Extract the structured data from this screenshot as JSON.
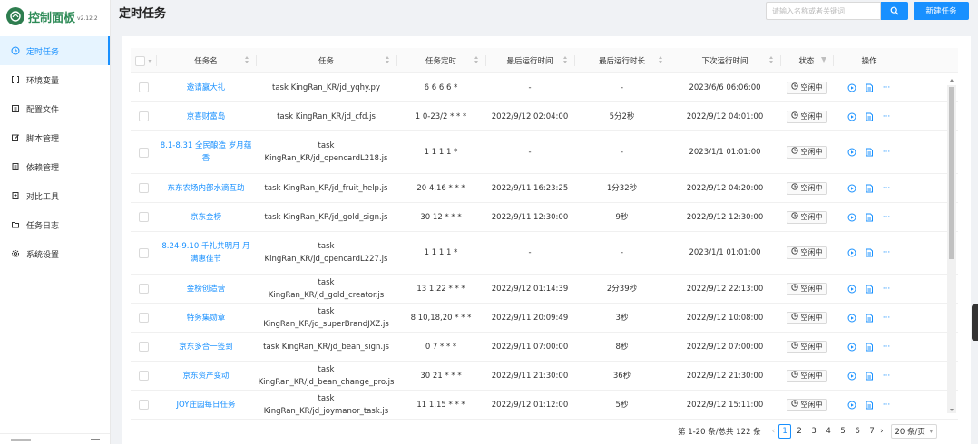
{
  "app": {
    "title": "控制面板",
    "version": "v2.12.2"
  },
  "sidebar": {
    "items": [
      {
        "label": "定时任务",
        "icon": "clock-icon",
        "active": true
      },
      {
        "label": "环境变量",
        "icon": "variable-icon",
        "active": false
      },
      {
        "label": "配置文件",
        "icon": "config-icon",
        "active": false
      },
      {
        "label": "脚本管理",
        "icon": "edit-icon",
        "active": false
      },
      {
        "label": "依赖管理",
        "icon": "dependency-icon",
        "active": false
      },
      {
        "label": "对比工具",
        "icon": "diff-icon",
        "active": false
      },
      {
        "label": "任务日志",
        "icon": "folder-icon",
        "active": false
      },
      {
        "label": "系统设置",
        "icon": "gear-icon",
        "active": false
      }
    ]
  },
  "header": {
    "title": "定时任务",
    "search_placeholder": "请输入名称或者关键词",
    "new_button": "新建任务"
  },
  "table": {
    "columns": [
      "任务名",
      "任务",
      "任务定时",
      "最后运行时间",
      "最后运行时长",
      "下次运行时间",
      "状态",
      "操作"
    ],
    "rows": [
      {
        "name": "邀请赢大礼",
        "task": "task KingRan_KR/jd_yqhy.py",
        "cron": "6 6 6 6 *",
        "last_run": "-",
        "duration": "-",
        "next_run": "2023/6/6 06:06:00",
        "status": "空闲中"
      },
      {
        "name": "京喜财富岛",
        "task": "task KingRan_KR/jd_cfd.js",
        "cron": "1 0-23/2 * * *",
        "last_run": "2022/9/12 02:04:00",
        "duration": "5分2秒",
        "next_run": "2022/9/12 04:01:00",
        "status": "空闲中"
      },
      {
        "name": "8.1-8.31 全民酿造 岁月蕴香",
        "task": "task KingRan_KR/jd_opencardL218.js",
        "cron": "1 1 1 1 *",
        "last_run": "-",
        "duration": "-",
        "next_run": "2023/1/1 01:01:00",
        "status": "空闲中"
      },
      {
        "name": "东东农场内部水滴互助",
        "task": "task KingRan_KR/jd_fruit_help.js",
        "cron": "20 4,16 * * *",
        "last_run": "2022/9/11 16:23:25",
        "duration": "1分32秒",
        "next_run": "2022/9/12 04:20:00",
        "status": "空闲中"
      },
      {
        "name": "京东金榜",
        "task": "task KingRan_KR/jd_gold_sign.js",
        "cron": "30 12 * * *",
        "last_run": "2022/9/11 12:30:00",
        "duration": "9秒",
        "next_run": "2022/9/12 12:30:00",
        "status": "空闲中"
      },
      {
        "name": "8.24-9.10 千礼共明月 月满惠佳节",
        "task": "task KingRan_KR/jd_opencardL227.js",
        "cron": "1 1 1 1 *",
        "last_run": "-",
        "duration": "-",
        "next_run": "2023/1/1 01:01:00",
        "status": "空闲中"
      },
      {
        "name": "金榜创造营",
        "task": "task KingRan_KR/jd_gold_creator.js",
        "cron": "13 1,22 * * *",
        "last_run": "2022/9/12 01:14:39",
        "duration": "2分39秒",
        "next_run": "2022/9/12 22:13:00",
        "status": "空闲中"
      },
      {
        "name": "特务集勋章",
        "task": "task KingRan_KR/jd_superBrandJXZ.js",
        "cron": "8 10,18,20 * * *",
        "last_run": "2022/9/11 20:09:49",
        "duration": "3秒",
        "next_run": "2022/9/12 10:08:00",
        "status": "空闲中"
      },
      {
        "name": "京东多合一签到",
        "task": "task KingRan_KR/jd_bean_sign.js",
        "cron": "0 7 * * *",
        "last_run": "2022/9/11 07:00:00",
        "duration": "8秒",
        "next_run": "2022/9/12 07:00:00",
        "status": "空闲中"
      },
      {
        "name": "京东资产变动",
        "task": "task KingRan_KR/jd_bean_change_pro.js",
        "cron": "30 21 * * *",
        "last_run": "2022/9/11 21:30:00",
        "duration": "36秒",
        "next_run": "2022/9/12 21:30:00",
        "status": "空闲中"
      },
      {
        "name": "JOY庄园每日任务",
        "task": "task KingRan_KR/jd_joymanor_task.js",
        "cron": "11 1,15 * * *",
        "last_run": "2022/9/12 01:12:00",
        "duration": "5秒",
        "next_run": "2022/9/12 15:11:00",
        "status": "空闲中"
      }
    ]
  },
  "pagination": {
    "total_text": "第 1-20 条/总共 122 条",
    "pages": [
      "1",
      "2",
      "3",
      "4",
      "5",
      "6",
      "7"
    ],
    "current": "1",
    "page_size": "20 条/页"
  },
  "colors": {
    "accent": "#1890ff",
    "brand": "#2e8b57"
  }
}
